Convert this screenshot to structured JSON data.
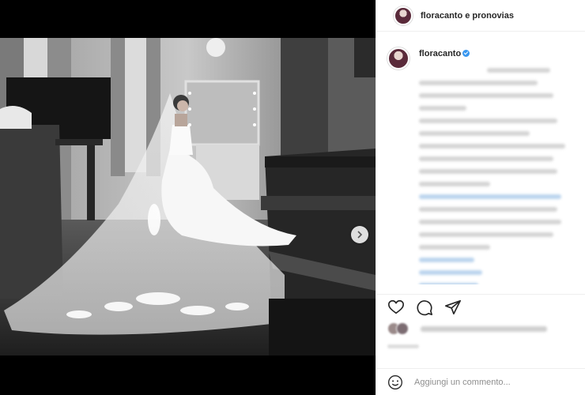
{
  "post": {
    "header_title": "floracanto e pronovias",
    "caption_username": "floracanto",
    "media_dots": 3,
    "active_dot": 0
  },
  "comment": {
    "placeholder": "Aggiungi un commento..."
  },
  "icons": {
    "like": "heart-icon",
    "comment": "comment-icon",
    "share": "send-icon",
    "emoji": "emoji-icon",
    "next": "chevron-right-icon"
  }
}
